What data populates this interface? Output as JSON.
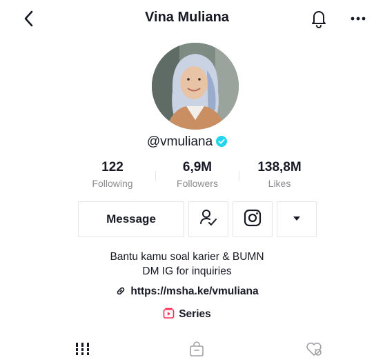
{
  "header": {
    "title": "Vina Muliana"
  },
  "profile": {
    "handle": "@vmuliana",
    "verified": true,
    "accent_color": "#20d5ec"
  },
  "stats": [
    {
      "value": "122",
      "label": "Following"
    },
    {
      "value": "6,9M",
      "label": "Followers"
    },
    {
      "value": "138,8M",
      "label": "Likes"
    }
  ],
  "actions": {
    "message_label": "Message",
    "icons": [
      "add-friend-icon",
      "instagram-icon",
      "dropdown-arrow-icon"
    ]
  },
  "bio": {
    "line1": "Bantu kamu soal karier & BUMN",
    "line2": "DM IG for inquiries"
  },
  "link": {
    "text": "https://msha.ke/vmuliana"
  },
  "series": {
    "label": "Series",
    "color": "#fe2c55"
  },
  "tabs": [
    "videos-grid-icon",
    "shop-bag-icon",
    "liked-heart-icon"
  ]
}
